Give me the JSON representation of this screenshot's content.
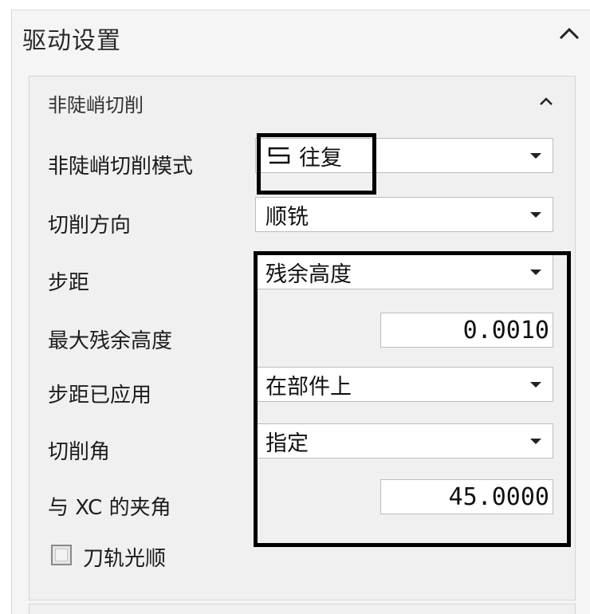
{
  "section": {
    "title": "驱动设置",
    "chevron_icon": "chevron-up-icon"
  },
  "group": {
    "title": "非陡峭切削",
    "chevron_icon": "chevron-up-icon"
  },
  "rows": {
    "mode": {
      "label": "非陡峭切削模式",
      "value": "往复",
      "icon": "zigzag-pattern-icon"
    },
    "direction": {
      "label": "切削方向",
      "value": "顺铣"
    },
    "stepover": {
      "label": "步距",
      "value": "残余高度"
    },
    "max_scallop": {
      "label": "最大残余高度",
      "value": "0.0010"
    },
    "stepover_applied": {
      "label": "步距已应用",
      "value": "在部件上"
    },
    "cut_angle": {
      "label": "切削角",
      "value": "指定"
    },
    "angle_xc": {
      "label": "与 XC 的夹角",
      "value": "45.0000"
    }
  },
  "smoothing": {
    "label": "刀轨光顺",
    "checked": false
  },
  "colors": {
    "highlight": "#000000",
    "panel_bg": "#f0f0f0",
    "field_bg": "#ffffff"
  }
}
